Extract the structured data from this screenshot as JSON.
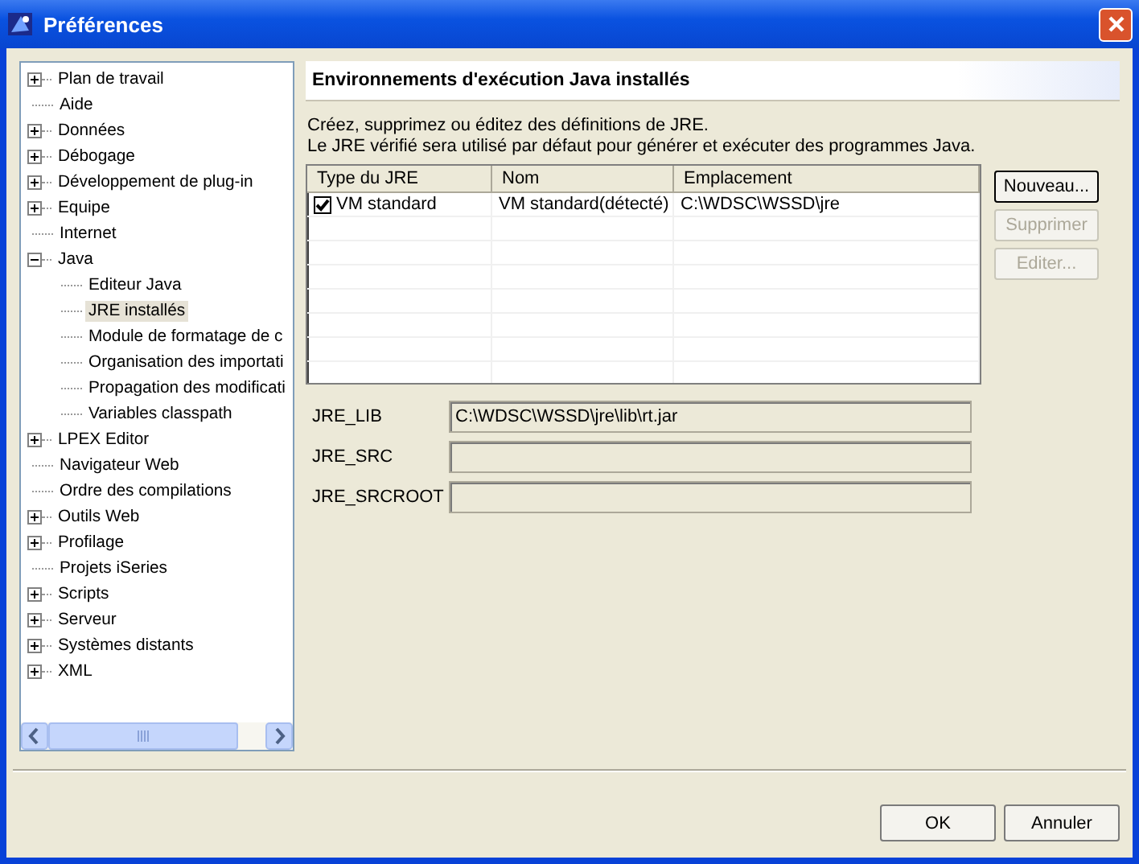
{
  "window": {
    "title": "Préférences"
  },
  "tree": [
    {
      "label": "Plan de travail",
      "expanded": false,
      "selected": false
    },
    {
      "label": "Aide",
      "selected": false
    },
    {
      "label": "Données",
      "expanded": false,
      "selected": false
    },
    {
      "label": "Débogage",
      "expanded": false,
      "selected": false
    },
    {
      "label": "Développement de plug-in",
      "expanded": false,
      "selected": false
    },
    {
      "label": "Equipe",
      "expanded": false,
      "selected": false
    },
    {
      "label": "Internet",
      "selected": false
    },
    {
      "label": "Java",
      "expanded": true,
      "selected": false,
      "children": [
        {
          "label": "Editeur Java",
          "selected": false
        },
        {
          "label": "JRE installés",
          "selected": true
        },
        {
          "label": "Module de formatage de c",
          "selected": false
        },
        {
          "label": "Organisation des importati",
          "selected": false
        },
        {
          "label": "Propagation des modificati",
          "selected": false
        },
        {
          "label": "Variables classpath",
          "selected": false
        }
      ]
    },
    {
      "label": "LPEX Editor",
      "expanded": false,
      "selected": false
    },
    {
      "label": "Navigateur Web",
      "selected": false
    },
    {
      "label": "Ordre des compilations",
      "selected": false
    },
    {
      "label": "Outils Web",
      "expanded": false,
      "selected": false
    },
    {
      "label": "Profilage",
      "expanded": false,
      "selected": false
    },
    {
      "label": "Projets iSeries",
      "selected": false
    },
    {
      "label": "Scripts",
      "expanded": false,
      "selected": false
    },
    {
      "label": "Serveur",
      "expanded": false,
      "selected": false
    },
    {
      "label": "Systèmes distants",
      "expanded": false,
      "selected": false
    },
    {
      "label": "XML",
      "expanded": false,
      "selected": false
    }
  ],
  "page": {
    "title": "Environnements d'exécution Java installés",
    "description": [
      "Créez, supprimez ou éditez des définitions de JRE.",
      "Le JRE vérifié sera utilisé par défaut pour générer et exécuter des programmes Java."
    ],
    "table": {
      "columns": [
        "Type du JRE",
        "Nom",
        "Emplacement"
      ],
      "rows": [
        {
          "cells": [
            "VM standard",
            "VM standard(détecté)",
            "C:\\WDSC\\WSSD\\jre"
          ],
          "checked": true
        }
      ]
    },
    "buttons": [
      {
        "label": "Nouveau...",
        "disabled": false
      },
      {
        "label": "Supprimer",
        "disabled": true
      },
      {
        "label": "Editer...",
        "disabled": true
      }
    ],
    "fields": [
      {
        "label": "JRE_LIB",
        "value": "C:\\WDSC\\WSSD\\jre\\lib\\rt.jar"
      },
      {
        "label": "JRE_SRC"
      },
      {
        "label": "JRE_SRCROOT"
      }
    ]
  },
  "buttons": [
    "OK",
    "Annuler"
  ]
}
